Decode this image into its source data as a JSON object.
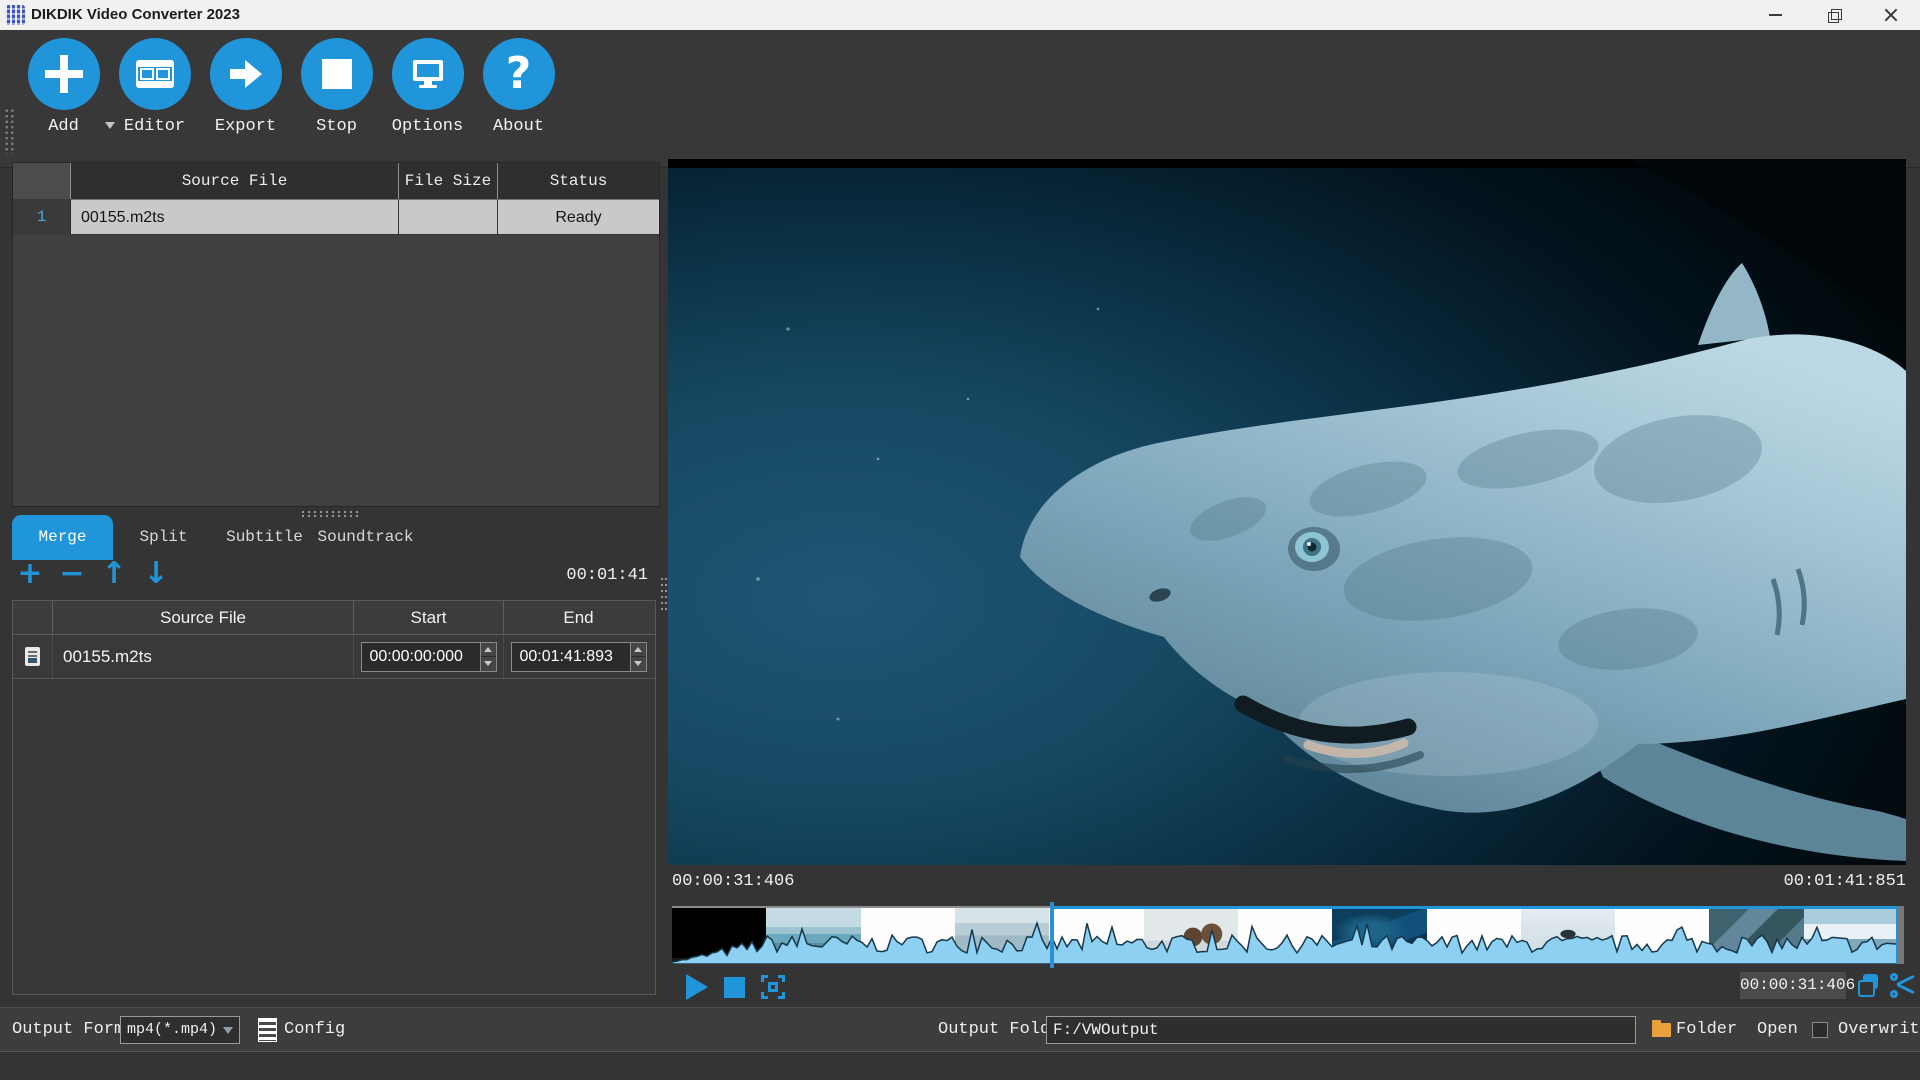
{
  "colors": {
    "accent": "#2095da",
    "waveform": "#8dd0f2",
    "selected_row": "#c9c9c9",
    "folder_icon": "#e9a23b",
    "title_bar": "#f1f1ef",
    "panel": "#343434"
  },
  "window": {
    "title": "DIKDIK Video Converter 2023"
  },
  "toolbar": {
    "buttons": [
      {
        "label": "Add",
        "icon": "plus-icon",
        "has_dropdown": true
      },
      {
        "label": "Editor",
        "icon": "film-icon"
      },
      {
        "label": "Export",
        "icon": "arrow-right-icon"
      },
      {
        "label": "Stop",
        "icon": "stop-icon"
      },
      {
        "label": "Options",
        "icon": "monitor-icon"
      },
      {
        "label": "About",
        "icon": "question-icon"
      }
    ]
  },
  "file_table": {
    "headers": [
      "Source File",
      "File Size",
      "Status"
    ],
    "rows": [
      {
        "index": "1",
        "source_file": "00155.m2ts",
        "file_size": "",
        "status": "Ready"
      }
    ]
  },
  "clip_tabs": [
    {
      "label": "Merge",
      "active": true
    },
    {
      "label": "Split",
      "active": false
    },
    {
      "label": "Subtitle",
      "active": false
    },
    {
      "label": "Soundtrack",
      "active": false
    }
  ],
  "merge_panel": {
    "duration": "00:01:41",
    "tools": [
      {
        "name": "add-clip",
        "glyph": "+"
      },
      {
        "name": "remove-clip",
        "glyph": "−"
      },
      {
        "name": "move-up",
        "glyph": "↑"
      },
      {
        "name": "move-down",
        "glyph": "↓"
      }
    ],
    "headers": [
      "Source File",
      "Start",
      "End"
    ],
    "rows": [
      {
        "source_file": "00155.m2ts",
        "start": "00:00:00:000",
        "end": "00:01:41:893"
      }
    ]
  },
  "preview": {
    "description": "Greenland shark swimming in deep blue water"
  },
  "timeline": {
    "start_time": "00:00:31:406",
    "end_time": "00:01:41:851",
    "current_time": "00:00:31:406",
    "playhead_percent": 30.8,
    "thumbnails": [
      "black",
      "iceberg",
      "white",
      "sea-horizon",
      "white",
      "people-on-ice",
      "white",
      "whales-underwater",
      "white",
      "helicopter",
      "white",
      "ice-floes",
      "iceberg-close"
    ]
  },
  "bottom_bar": {
    "output_format_label": "Output Format",
    "format_value": "mp4(*.mp4)",
    "config_label": "Config",
    "output_folder_label": "Output Folder",
    "folder_value": "F:/VWOutput",
    "folder_button_label": "Folder",
    "open_label": "Open",
    "overwrite_label": "Overwrite",
    "overwrite_checked": false
  }
}
